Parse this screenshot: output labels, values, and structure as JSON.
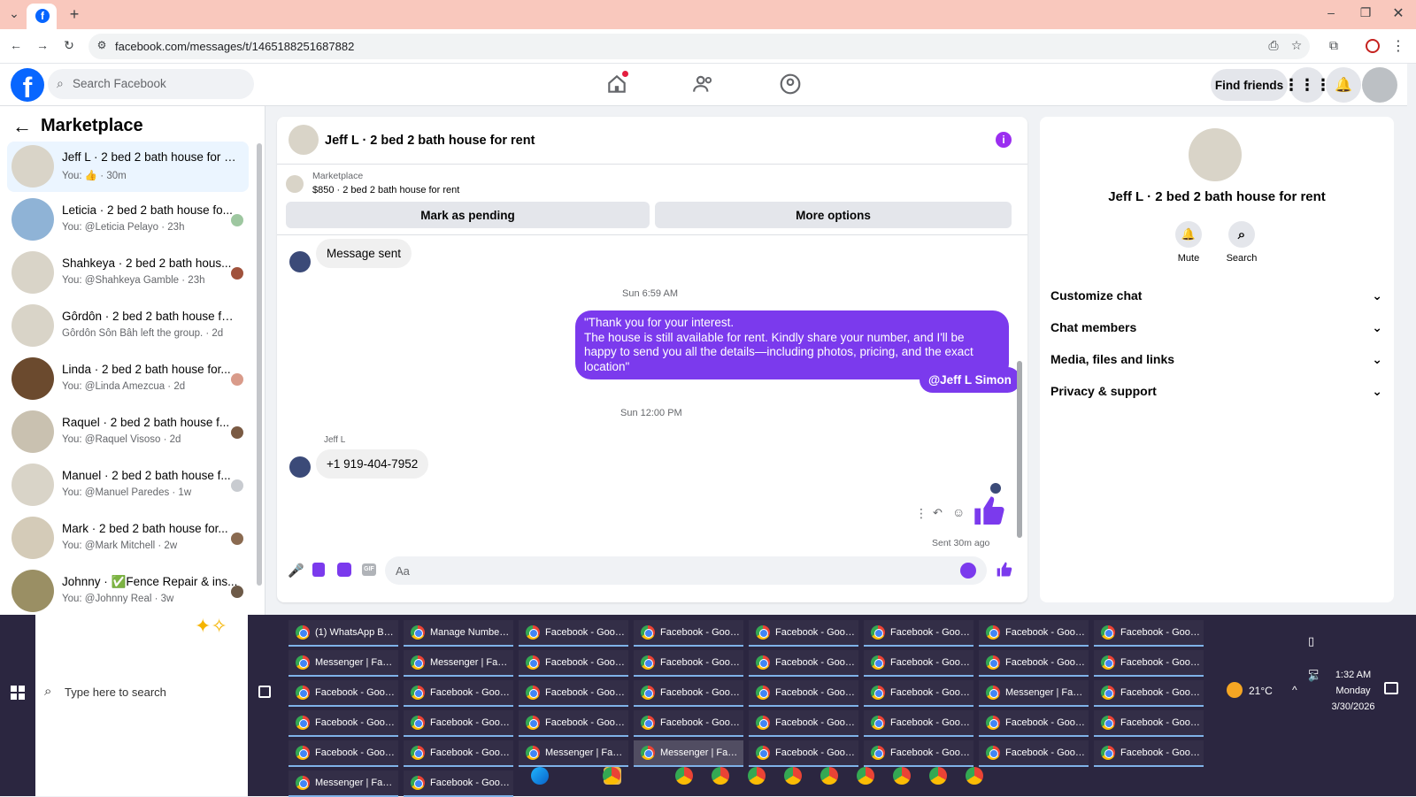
{
  "browser": {
    "url": "facebook.com/messages/t/1465188251687882"
  },
  "header": {
    "search_placeholder": "Search Facebook",
    "find_friends": "Find friends"
  },
  "sidebar": {
    "title": "Marketplace",
    "conversations": [
      {
        "title": "Jeff L · 2 bed 2 bath house for re...",
        "sub": "You: 👍 · 30m"
      },
      {
        "title": "Leticia · 2 bed 2 bath house fo...",
        "sub": "You: @Leticia Pelayo · 23h"
      },
      {
        "title": "Shahkeya · 2 bed 2 bath hous...",
        "sub": "You: @Shahkeya Gamble · 23h"
      },
      {
        "title": "Gôrdôn · 2 bed 2 bath house for...",
        "sub": "Gôrdôn Sôn Bâh left the group. · 2d"
      },
      {
        "title": "Linda · 2 bed 2 bath house for...",
        "sub": "You: @Linda Amezcua · 2d"
      },
      {
        "title": "Raquel · 2 bed 2 bath house f...",
        "sub": "You: @Raquel Visoso · 2d"
      },
      {
        "title": "Manuel · 2 bed 2 bath house f...",
        "sub": "You: @Manuel Paredes · 1w"
      },
      {
        "title": "Mark · 2 bed 2 bath house for...",
        "sub": "You: @Mark Mitchell · 2w"
      },
      {
        "title": "Johnny · ✅Fence Repair & ins...",
        "sub": "You: @Johnny Real · 3w"
      }
    ]
  },
  "chat": {
    "title": "Jeff L · 2 bed 2 bath house for rent",
    "listing_label": "Marketplace",
    "listing_price": "$850 · 2 bed 2 bath house for rent",
    "mark_pending": "Mark as pending",
    "more_options": "More options",
    "msg_sent": "Message sent",
    "ts1": "Sun 6:59 AM",
    "out_msg": "\"Thank you for your interest.\nThe house is still available for rent. Kindly share your number, and I'll be happy to send you all the details—including photos, pricing, and the exact location\"",
    "mention": "@Jeff L Simon",
    "ts2": "Sun 12:00 PM",
    "sender": "Jeff L",
    "in_msg": "+1 919-404-7952",
    "sent_status": "Sent 30m ago",
    "composer_placeholder": "Aa"
  },
  "info": {
    "name": "Jeff L · 2 bed 2 bath house for rent",
    "mute": "Mute",
    "search": "Search",
    "sections": [
      "Customize chat",
      "Chat members",
      "Media, files and links",
      "Privacy & support"
    ]
  },
  "taskbar": {
    "search_placeholder": "Type here to search",
    "weather": "21°C",
    "time": "1:32 AM",
    "day": "Monday",
    "date": "3/30/2026",
    "windows": [
      "(1) WhatsApp Busi...",
      "Manage Numbers ...",
      "Facebook - Googl...",
      "Facebook - Googl...",
      "Facebook - Googl...",
      "Facebook - Googl...",
      "Facebook - Googl...",
      "Facebook - Googl...",
      "Messenger | Faceb...",
      "Messenger | Faceb...",
      "Facebook - Googl...",
      "Facebook - Googl...",
      "Facebook - Googl...",
      "Facebook - Googl...",
      "Facebook - Googl...",
      "Facebook - Googl...",
      "Facebook - Googl...",
      "Facebook - Googl...",
      "Facebook - Googl...",
      "Facebook - Googl...",
      "Facebook - Googl...",
      "Facebook - Googl...",
      "Messenger | Faceb...",
      "Facebook - Googl...",
      "Facebook - Googl...",
      "Facebook - Googl...",
      "Facebook - Googl...",
      "Facebook - Googl...",
      "Facebook - Googl...",
      "Facebook - Googl...",
      "Facebook - Googl...",
      "Facebook - Googl...",
      "Facebook - Googl...",
      "Facebook - Googl...",
      "Messenger | Faceb...",
      "Messenger | Faceb...",
      "Facebook - Googl...",
      "Facebook - Googl...",
      "Facebook - Googl...",
      "Facebook - Googl...",
      "Messenger | Faceb...",
      "Facebook - Google ..."
    ]
  },
  "colors": {
    "brand": "#0866ff",
    "bubble_out": "#7b3aed",
    "taskbar": "#2b2640"
  }
}
